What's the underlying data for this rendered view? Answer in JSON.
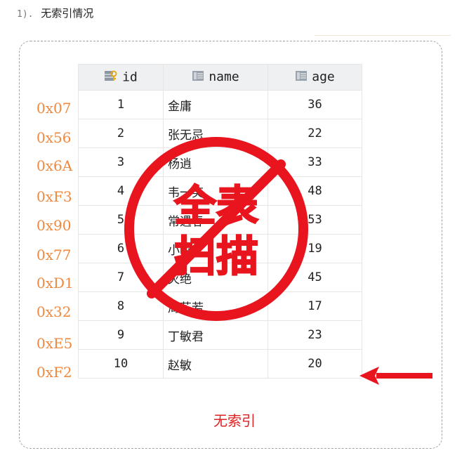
{
  "heading": {
    "number": "1).",
    "title": "无索引情况"
  },
  "table": {
    "columns": [
      {
        "label": "id",
        "icon": "key-icon"
      },
      {
        "label": "name",
        "icon": "column-icon"
      },
      {
        "label": "age",
        "icon": "column-icon"
      }
    ],
    "rows": [
      {
        "addr": "0x07",
        "id": "1",
        "name": "金庸",
        "age": "36"
      },
      {
        "addr": "0x56",
        "id": "2",
        "name": "张无忌",
        "age": "22"
      },
      {
        "addr": "0x6A",
        "id": "3",
        "name": "杨逍",
        "age": "33"
      },
      {
        "addr": "0xF3",
        "id": "4",
        "name": "韦一笑",
        "age": "48"
      },
      {
        "addr": "0x90",
        "id": "5",
        "name": "常遇春",
        "age": "53"
      },
      {
        "addr": "0x77",
        "id": "6",
        "name": "小昭",
        "age": "19"
      },
      {
        "addr": "0xD1",
        "id": "7",
        "name": "灭绝",
        "age": "45"
      },
      {
        "addr": "0x32",
        "id": "8",
        "name": "周芷若",
        "age": "17"
      },
      {
        "addr": "0xE5",
        "id": "9",
        "name": "丁敏君",
        "age": "23"
      },
      {
        "addr": "0xF2",
        "id": "10",
        "name": "赵敏",
        "age": "20"
      }
    ]
  },
  "stamp": {
    "line1": "全表",
    "line2": "扫描",
    "color": "#e8141e"
  },
  "arrow_color": "#e8141e",
  "caption": "无索引"
}
